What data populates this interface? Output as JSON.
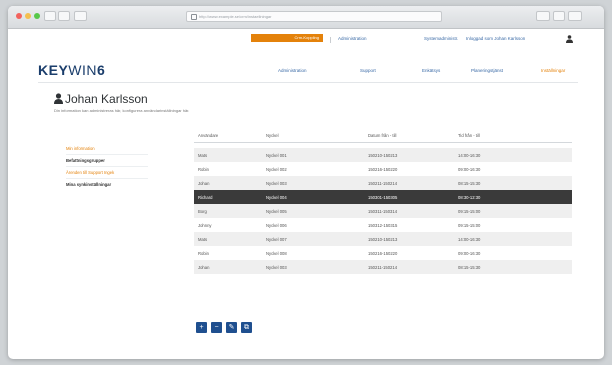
{
  "browser": {
    "url": "http://www.example.se/crm/instaellningar"
  },
  "topbar": {
    "crm_badge": "Crm-Koppling",
    "link_1": "Administration",
    "link_2": "Systemadministr.",
    "link_3": "Inloggad som Johan Karlsson"
  },
  "brand": {
    "logo_a": "KEY",
    "logo_b": "WIN",
    "logo_c": "6"
  },
  "nav": {
    "items": [
      "Administration",
      "Support",
      "Enkätsys",
      "Planeringstjänst",
      "Inställningar"
    ]
  },
  "page": {
    "title": "Johan Karlsson",
    "subtitle": "Din information kan administreras här, konfigurera användarinställningar här."
  },
  "sidebar": {
    "items": [
      "Min information",
      "Befattningsgrupper",
      "Ärenden till Support Ingek",
      "Mina synkinställningar"
    ]
  },
  "table": {
    "headers": [
      "Användare",
      "Nyckel",
      "Datum från - till",
      "Tid från - till"
    ],
    "rows": [
      {
        "user": "Mats",
        "key": "Nyckel 001",
        "date": "150210-150213",
        "time": "14:00-16:30"
      },
      {
        "user": "Robin",
        "key": "Nyckel 002",
        "date": "150216-150220",
        "time": "09:00-16:30"
      },
      {
        "user": "Johan",
        "key": "Nyckel 003",
        "date": "150211-150214",
        "time": "08:15-15:30"
      },
      {
        "user": "Richard",
        "key": "Nyckel 004",
        "date": "150301-150305",
        "time": "08:30-12:30"
      },
      {
        "user": "Borg",
        "key": "Nyckel 005",
        "date": "150311-150314",
        "time": "09:15-15:00"
      },
      {
        "user": "Johnny",
        "key": "Nyckel 006",
        "date": "150312-150315",
        "time": "09:15-15:00"
      },
      {
        "user": "Mats",
        "key": "Nyckel 007",
        "date": "150210-150213",
        "time": "14:00-16:30"
      },
      {
        "user": "Robin",
        "key": "Nyckel 008",
        "date": "150216-150220",
        "time": "09:00-16:30"
      },
      {
        "user": "Johan",
        "key": "Nyckel 003",
        "date": "150211-150214",
        "time": "08:15-15:30"
      }
    ]
  },
  "actions": {
    "add": "+",
    "remove": "−",
    "edit": "✎",
    "copy": "⧉"
  },
  "colors": {
    "brand_blue": "#1a3d6b",
    "accent_orange": "#e4820b",
    "button_blue": "#1f4f8f",
    "selected_row": "#3a3a3a"
  },
  "icons": {
    "user": "user-icon",
    "add": "plus-icon",
    "remove": "minus-icon",
    "edit": "pencil-icon",
    "copy": "copy-icon"
  }
}
